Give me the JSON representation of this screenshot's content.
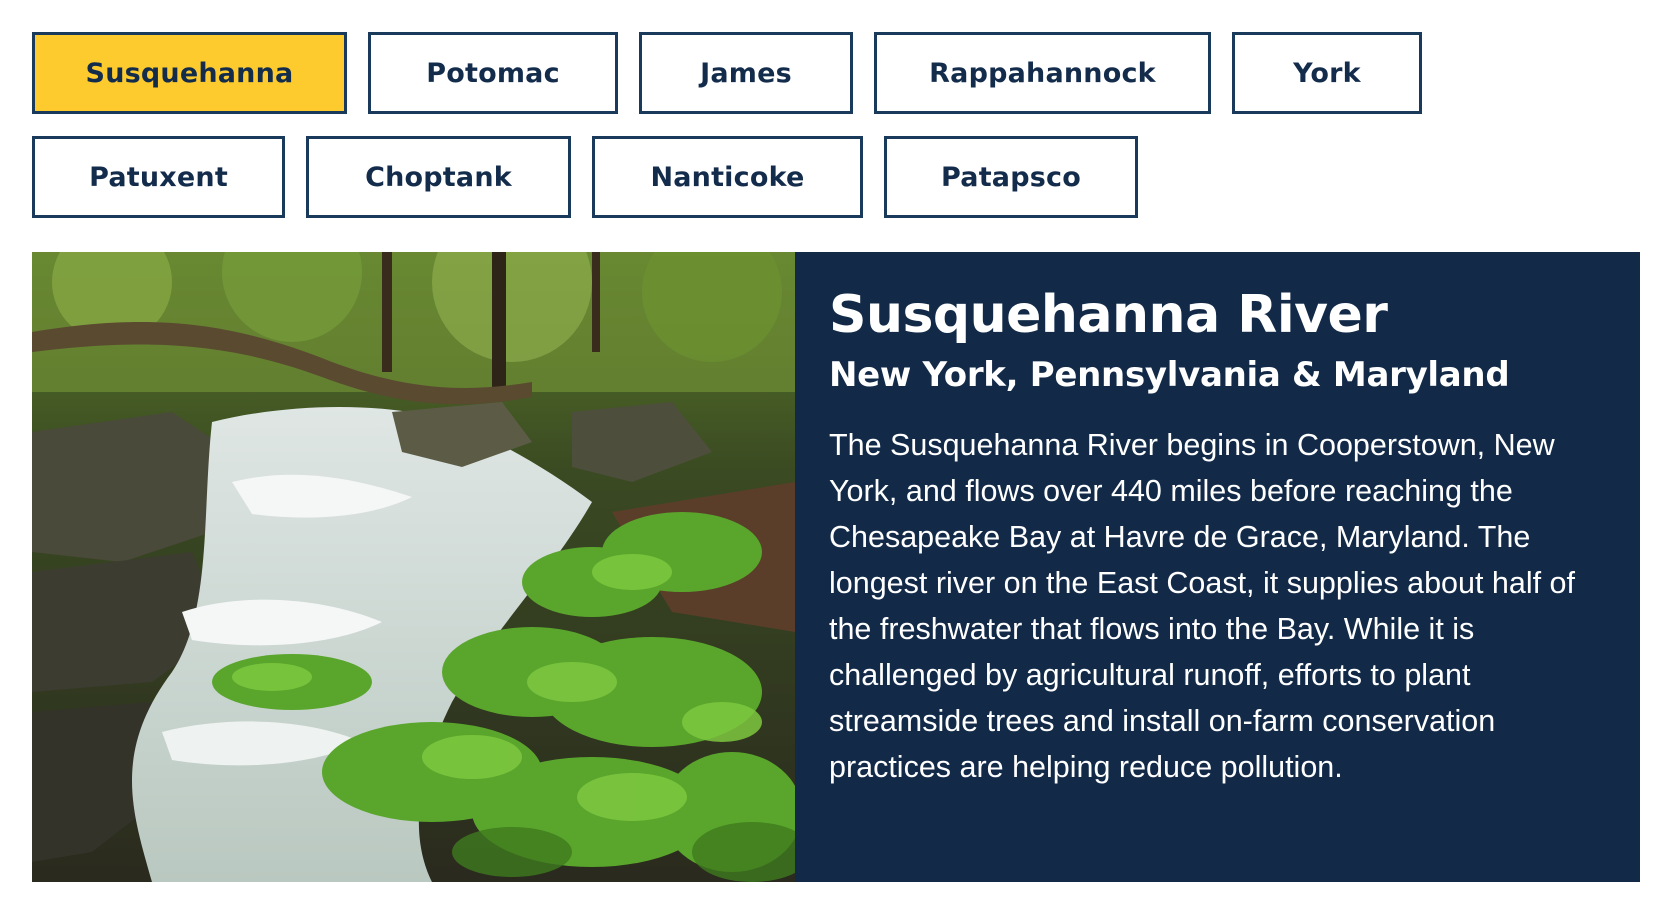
{
  "tabs": [
    {
      "label": "Susquehanna",
      "active": true
    },
    {
      "label": "Potomac",
      "active": false
    },
    {
      "label": "James",
      "active": false
    },
    {
      "label": "Rappahannock",
      "active": false
    },
    {
      "label": "York",
      "active": false
    },
    {
      "label": "Patuxent",
      "active": false
    },
    {
      "label": "Choptank",
      "active": false
    },
    {
      "label": "Nanticoke",
      "active": false
    },
    {
      "label": "Patapsco",
      "active": false
    }
  ],
  "river": {
    "title": "Susquehanna River",
    "states": "New York, Pennsylvania & Maryland",
    "description": "The Susquehanna River begins in Cooperstown, New York, and flows over 440 miles before reaching the Chesapeake Bay at Havre de Grace, Maryland. The longest river on the East Coast, it supplies about half of the freshwater that flows into the Bay. While it is challenged by agricultural runoff, efforts to plant streamside trees and install on-farm conservation practices are helping reduce pollution."
  },
  "colors": {
    "active_tab": "#fdcb2e",
    "tab_border": "#1a3a5c",
    "tab_text": "#142c4c",
    "panel_bg": "#122a48"
  }
}
